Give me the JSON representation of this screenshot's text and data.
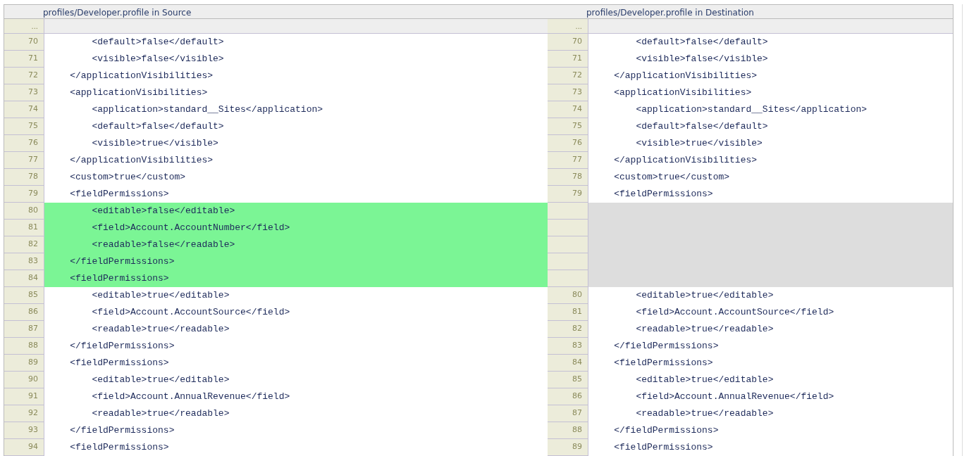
{
  "panes": [
    {
      "title": "profiles/Developer.profile in Source"
    },
    {
      "title": "profiles/Developer.profile in Destination"
    }
  ],
  "ellipsis": [
    "...",
    "..."
  ],
  "rows": [
    {
      "kind": "same",
      "left": {
        "num": "70",
        "code": "        <default>false</default>"
      },
      "right": {
        "num": "70",
        "code": "        <default>false</default>"
      }
    },
    {
      "kind": "same",
      "left": {
        "num": "71",
        "code": "        <visible>false</visible>"
      },
      "right": {
        "num": "71",
        "code": "        <visible>false</visible>"
      }
    },
    {
      "kind": "same",
      "left": {
        "num": "72",
        "code": "    </applicationVisibilities>"
      },
      "right": {
        "num": "72",
        "code": "    </applicationVisibilities>"
      }
    },
    {
      "kind": "same",
      "left": {
        "num": "73",
        "code": "    <applicationVisibilities>"
      },
      "right": {
        "num": "73",
        "code": "    <applicationVisibilities>"
      }
    },
    {
      "kind": "same",
      "left": {
        "num": "74",
        "code": "        <application>standard__Sites</application>"
      },
      "right": {
        "num": "74",
        "code": "        <application>standard__Sites</application>"
      }
    },
    {
      "kind": "same",
      "left": {
        "num": "75",
        "code": "        <default>false</default>"
      },
      "right": {
        "num": "75",
        "code": "        <default>false</default>"
      }
    },
    {
      "kind": "same",
      "left": {
        "num": "76",
        "code": "        <visible>true</visible>"
      },
      "right": {
        "num": "76",
        "code": "        <visible>true</visible>"
      }
    },
    {
      "kind": "same",
      "left": {
        "num": "77",
        "code": "    </applicationVisibilities>"
      },
      "right": {
        "num": "77",
        "code": "    </applicationVisibilities>"
      }
    },
    {
      "kind": "same",
      "left": {
        "num": "78",
        "code": "    <custom>true</custom>"
      },
      "right": {
        "num": "78",
        "code": "    <custom>true</custom>"
      }
    },
    {
      "kind": "same",
      "left": {
        "num": "79",
        "code": "    <fieldPermissions>"
      },
      "right": {
        "num": "79",
        "code": "    <fieldPermissions>"
      }
    },
    {
      "kind": "added",
      "left": {
        "num": "80",
        "code": "        <editable>false</editable>"
      }
    },
    {
      "kind": "added",
      "left": {
        "num": "81",
        "code": "        <field>Account.AccountNumber</field>"
      }
    },
    {
      "kind": "added",
      "left": {
        "num": "82",
        "code": "        <readable>false</readable>"
      }
    },
    {
      "kind": "added",
      "left": {
        "num": "83",
        "code": "    </fieldPermissions>"
      }
    },
    {
      "kind": "added",
      "left": {
        "num": "84",
        "code": "    <fieldPermissions>"
      }
    },
    {
      "kind": "same",
      "left": {
        "num": "85",
        "code": "        <editable>true</editable>"
      },
      "right": {
        "num": "80",
        "code": "        <editable>true</editable>"
      }
    },
    {
      "kind": "same",
      "left": {
        "num": "86",
        "code": "        <field>Account.AccountSource</field>"
      },
      "right": {
        "num": "81",
        "code": "        <field>Account.AccountSource</field>"
      }
    },
    {
      "kind": "same",
      "left": {
        "num": "87",
        "code": "        <readable>true</readable>"
      },
      "right": {
        "num": "82",
        "code": "        <readable>true</readable>"
      }
    },
    {
      "kind": "same",
      "left": {
        "num": "88",
        "code": "    </fieldPermissions>"
      },
      "right": {
        "num": "83",
        "code": "    </fieldPermissions>"
      }
    },
    {
      "kind": "same",
      "left": {
        "num": "89",
        "code": "    <fieldPermissions>"
      },
      "right": {
        "num": "84",
        "code": "    <fieldPermissions>"
      }
    },
    {
      "kind": "same",
      "left": {
        "num": "90",
        "code": "        <editable>true</editable>"
      },
      "right": {
        "num": "85",
        "code": "        <editable>true</editable>"
      }
    },
    {
      "kind": "same",
      "left": {
        "num": "91",
        "code": "        <field>Account.AnnualRevenue</field>"
      },
      "right": {
        "num": "86",
        "code": "        <field>Account.AnnualRevenue</field>"
      }
    },
    {
      "kind": "same",
      "left": {
        "num": "92",
        "code": "        <readable>true</readable>"
      },
      "right": {
        "num": "87",
        "code": "        <readable>true</readable>"
      }
    },
    {
      "kind": "same",
      "left": {
        "num": "93",
        "code": "    </fieldPermissions>"
      },
      "right": {
        "num": "88",
        "code": "    </fieldPermissions>"
      }
    },
    {
      "kind": "same",
      "left": {
        "num": "94",
        "code": "    <fieldPermissions>"
      },
      "right": {
        "num": "89",
        "code": "    <fieldPermissions>"
      }
    }
  ]
}
